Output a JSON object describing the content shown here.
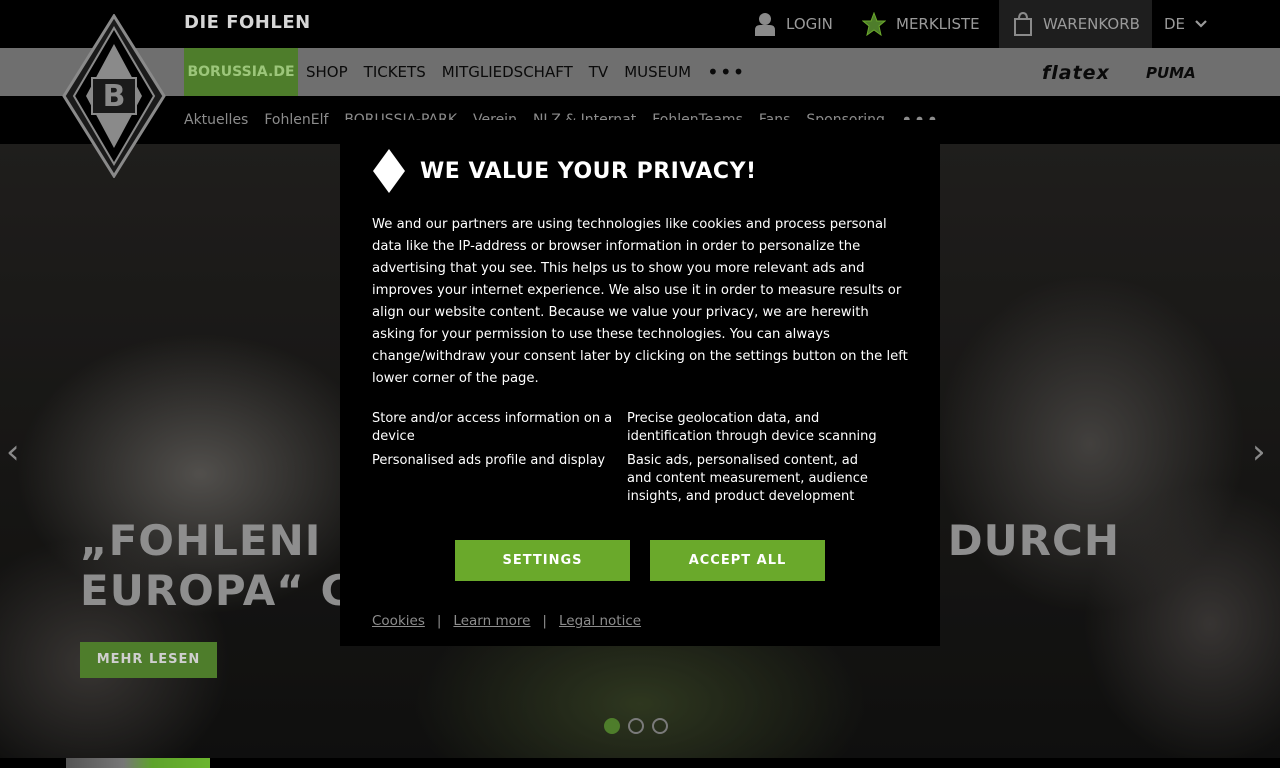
{
  "header": {
    "site_name": "DIE FOHLEN",
    "login": "LOGIN",
    "watchlist": "MERKLISTE",
    "cart": "WARENKORB",
    "language": "DE"
  },
  "nav": {
    "active": "BORUSSIA.DE",
    "items": [
      "SHOP",
      "TICKETS",
      "MITGLIEDSCHAFT",
      "TV",
      "MUSEUM"
    ],
    "more": "•••",
    "sponsors": [
      "flatex",
      "PUMA"
    ]
  },
  "subnav": {
    "items": [
      "Aktuelles",
      "FohlenElf",
      "BORUSSIA-PARK",
      "Verein",
      "NLZ & Internat",
      "FohlenTeams",
      "Fans",
      "Sponsoring"
    ],
    "more": "•••"
  },
  "hero": {
    "title_line1": "„FOHLENI",
    "title_line1_end": "DURCH",
    "title_line2": "EUROPA“ C",
    "read_more": "MEHR LESEN",
    "slides": 3,
    "active_slide": 1
  },
  "privacy": {
    "title": "WE VALUE YOUR PRIVACY!",
    "body": "We and our partners are using technologies like cookies and process personal data like the IP-address or browser information in order to personalize the advertising that you see. This helps us to show you more relevant ads and improves your internet experience. We also use it in order to measure results or align our website content. Because we value your privacy, we are herewith asking for your permission to use these technologies. You can always change/withdraw your consent later by clicking on the settings button on the left lower corner of the page.",
    "purposes": [
      "Store and/or access information on a device",
      "Precise geolocation data, and identification through device scanning",
      "Personalised ads profile and display",
      "Basic ads, personalised content, ad and content measurement, audience insights, and product development"
    ],
    "settings_label": "SETTINGS",
    "accept_label": "ACCEPT ALL",
    "links": [
      "Cookies",
      "Learn more",
      "Legal notice"
    ],
    "separator": "|"
  },
  "colors": {
    "brand_green": "#6aa92b",
    "dark_green": "#4e7d2b",
    "nav_grey": "#6f6f6f"
  }
}
